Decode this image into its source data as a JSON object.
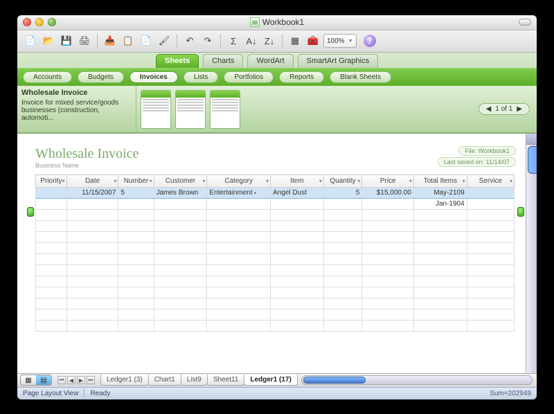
{
  "window": {
    "title": "Workbook1"
  },
  "toolbar": {
    "zoom": "100%"
  },
  "ribbon": {
    "tabs": [
      "Sheets",
      "Charts",
      "WordArt",
      "SmartArt Graphics"
    ],
    "active": 0,
    "subtabs": [
      "Accounts",
      "Budgets",
      "Invoices",
      "Lists",
      "Portfolios",
      "Reports",
      "Blank Sheets"
    ],
    "active_sub": 2,
    "desc_title": "Wholesale Invoice",
    "desc_body": "Invoice for mixed service/goods businesses (construction, automoti...",
    "pager": "1 of 1"
  },
  "doc": {
    "title": "Wholesale Invoice",
    "subtitle": "Business Name",
    "file_chip": "File: Workbook1",
    "saved_chip": "Last saved on: 11/14/07",
    "columns": [
      "Priority",
      "Date",
      "Number",
      "Customer",
      "Category",
      "Item",
      "Quantity",
      "Price",
      "Total Items",
      "Service"
    ],
    "row": {
      "priority": "",
      "date": "11/15/2007",
      "number": "5",
      "customer": "James Brown",
      "category": "Entertainment",
      "item": "Angel Dust",
      "quantity": "5",
      "price": "$15,000.00",
      "total_items": "May-2109",
      "service": ""
    },
    "row2_total_items": "Jan-1904"
  },
  "sheets": [
    "Ledger1 (3)",
    "Chart1",
    "List9",
    "Sheet11",
    "Ledger1 (17)"
  ],
  "active_sheet": 4,
  "status": {
    "mode": "Page Layout View",
    "state": "Ready",
    "sum": "Sum=202949"
  }
}
